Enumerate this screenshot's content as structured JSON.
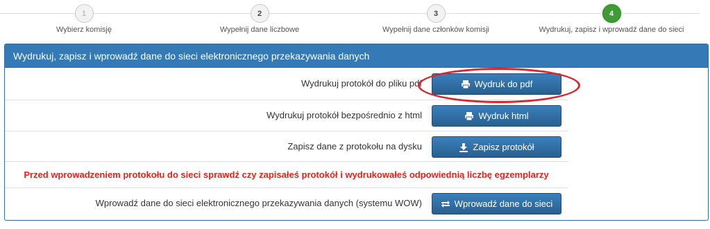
{
  "wizard": {
    "steps": [
      {
        "number": "1",
        "label": "Wybierz komisję"
      },
      {
        "number": "2",
        "label": "Wypełnij dane liczbowe"
      },
      {
        "number": "3",
        "label": "Wypełnij dane członków komisji"
      },
      {
        "number": "4",
        "label": "Wydrukuj, zapisz i wprowadź dane do sieci"
      }
    ],
    "active_step": 4
  },
  "panel": {
    "title": "Wydrukuj, zapisz i wprowadź dane do sieci elektronicznego przekazywania danych",
    "rows": [
      {
        "label": "Wydrukuj protokół do pliku pdf",
        "button": "Wydruk do pdf",
        "icon": "print-icon"
      },
      {
        "label": "Wydrukuj protokół bezpośrednio z html",
        "button": "Wydruk html",
        "icon": "print-icon"
      },
      {
        "label": "Zapisz dane z protokołu na dysku",
        "button": "Zapisz protokół",
        "icon": "download-icon"
      }
    ],
    "warning": "Przed wprowadzeniem protokołu do sieci sprawdź czy zapisałeś protokół i wydrukowałeś odpowiednią liczbę egzemplarzy",
    "submit_row": {
      "label": "Wprowadź dane do sieci elektronicznego przekazywania danych (systemu WOW)",
      "button": "Wprowadź dane do sieci",
      "icon": "exchange-icon"
    }
  },
  "colors": {
    "panel_header": "#337ab7",
    "button": "#286090",
    "warning_text": "#e8201c",
    "active_step": "#3f9c35",
    "annotation_ellipse": "#d9262b"
  }
}
